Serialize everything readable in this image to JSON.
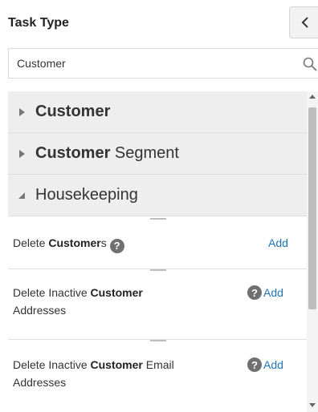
{
  "header": {
    "title": "Task Type",
    "collapse_icon": "chevron-left-icon"
  },
  "search": {
    "value": "Customer",
    "icon": "search-icon"
  },
  "categories": [
    {
      "bold": "Customer",
      "rest": "",
      "state": "collapsed"
    },
    {
      "bold": "Customer",
      "rest": " Segment",
      "state": "collapsed"
    },
    {
      "bold": "",
      "rest": "Housekeeping",
      "state": "expanded"
    }
  ],
  "tasks": [
    {
      "pre": "Delete ",
      "bold": "Customer",
      "post": "s",
      "line2": "",
      "help": "?",
      "add": "Add"
    },
    {
      "pre": "Delete Inactive ",
      "bold": "Customer",
      "post": "",
      "line2": "Addresses",
      "help": "?",
      "add": "Add"
    },
    {
      "pre": "Delete Inactive ",
      "bold": "Customer",
      "post": " Email",
      "line2": "Addresses",
      "help": "?",
      "add": "Add"
    }
  ],
  "colors": {
    "link": "#1f73b7",
    "category_bg": "#eeeeee"
  }
}
